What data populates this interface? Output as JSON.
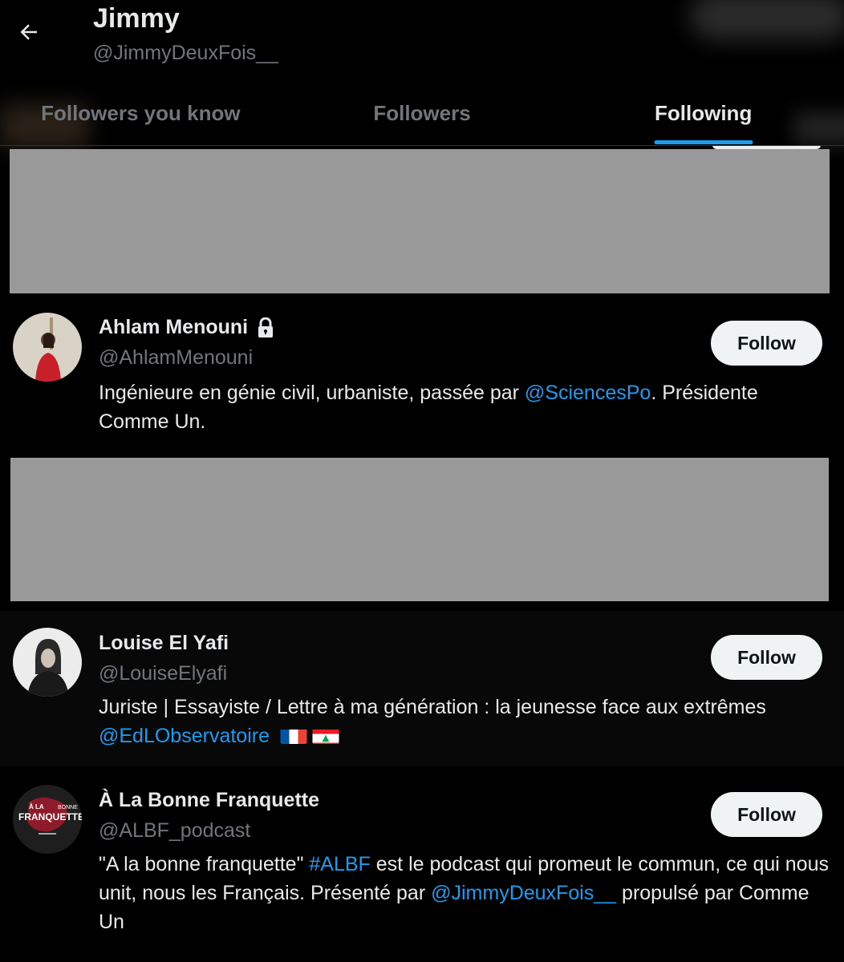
{
  "header": {
    "title": "Jimmy",
    "handle": "@JimmyDeuxFois__"
  },
  "tabs": [
    {
      "label": "Followers you know",
      "active": false
    },
    {
      "label": "Followers",
      "active": false
    },
    {
      "label": "Following",
      "active": true
    }
  ],
  "colors": {
    "background": "#000000",
    "link": "#1d9bf0",
    "muted": "#71767b",
    "button_bg": "#eff3f4",
    "redaction": "#999999"
  },
  "users": [
    {
      "name": "Ahlam Menouni",
      "handle": "@AhlamMenouni",
      "locked": true,
      "follow_label": "Follow",
      "bio_parts": [
        {
          "text": "Ingénieure en génie civil, urbaniste, passée par ",
          "link": false
        },
        {
          "text": "@SciencesPo",
          "link": true
        },
        {
          "text": ". Présidente Comme Un.",
          "link": false
        }
      ]
    },
    {
      "name": "Louise El Yafi",
      "handle": "@LouiseElyafi",
      "locked": false,
      "follow_label": "Follow",
      "bio_parts": [
        {
          "text": "Juriste | Essayiste / Lettre à ma génération : la jeunesse face aux extrêmes ",
          "link": false
        },
        {
          "text": "@EdLObservatoire",
          "link": true
        }
      ],
      "bio_flags": [
        "france-flag",
        "lebanon-flag"
      ]
    },
    {
      "name": "À La Bonne Franquette",
      "handle": "@ALBF_podcast",
      "locked": false,
      "follow_label": "Follow",
      "avatar_logo": {
        "line1": "À LA",
        "line2": "BONNE",
        "line3": "FRANQUETTE"
      },
      "bio_parts": [
        {
          "text": "\"A la bonne franquette\" ",
          "link": false
        },
        {
          "text": "#ALBF",
          "link": true
        },
        {
          "text": " est le podcast qui promeut le commun, ce qui nous unit, nous les Français. Présenté par ",
          "link": false
        },
        {
          "text": "@JimmyDeuxFois__",
          "link": true
        },
        {
          "text": " propulsé par Comme Un",
          "link": false
        }
      ]
    }
  ]
}
